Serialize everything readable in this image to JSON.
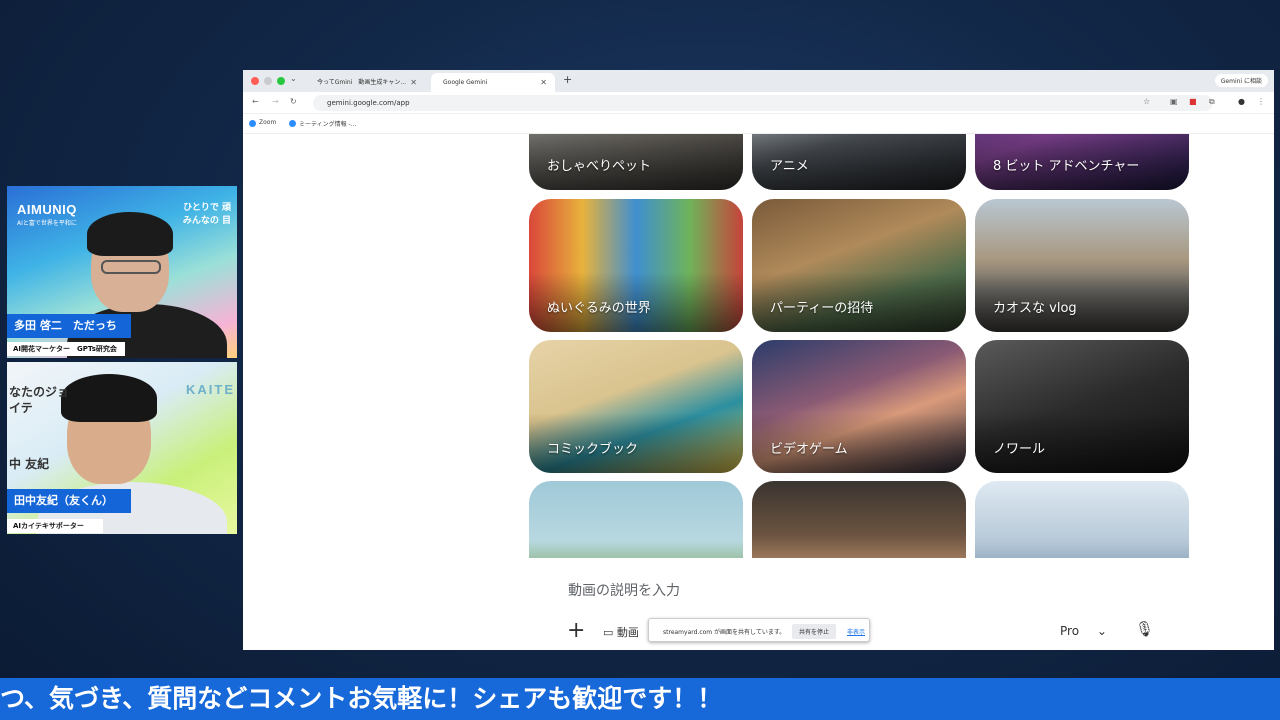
{
  "stream": {
    "ticker_text": "つ、気づき、質問などコメントお気軽に！シェアも歓迎です！！"
  },
  "webcam1": {
    "brand": "AIMUNIQ",
    "brand_sub": "AIと富で世界を平和に",
    "tag_line1": "ひとりで 頑",
    "tag_line2": "みんなの 目",
    "name": "多田 啓二　ただっち",
    "role": "AI開花マーケター　GPTs研究会"
  },
  "webcam2": {
    "tag": "KAITE",
    "side_line1": "なたのジョ",
    "side_line2": "イテ",
    "side_line3": "中 友紀",
    "name": "田中友紀（友くん）",
    "role": "AIカイテキサポーター"
  },
  "browser": {
    "tabs": [
      {
        "label": "今ってGmini　動画生成キャン..."
      },
      {
        "label": "Google Gemini"
      }
    ],
    "new_tab": "+",
    "gemini_button": "Gemini に相談",
    "url": "gemini.google.com/app",
    "bookmarks": [
      {
        "label": "Zoom"
      },
      {
        "label": "ミーティング情報 -..."
      }
    ]
  },
  "gemini": {
    "cards": [
      {
        "label": "おしゃべりペット"
      },
      {
        "label": "アニメ"
      },
      {
        "label": "8 ビット アドベンチャー"
      },
      {
        "label": "ぬいぐるみの世界"
      },
      {
        "label": "パーティーの招待"
      },
      {
        "label": "カオスな vlog"
      },
      {
        "label": "コミックブック"
      },
      {
        "label": "ビデオゲーム"
      },
      {
        "label": "ノワール"
      },
      {
        "label": ""
      },
      {
        "label": ""
      },
      {
        "label": ""
      }
    ],
    "prompt_placeholder": "動画の説明を入力",
    "plus": "+",
    "video_chip": "動画",
    "model": "Pro",
    "share_bar": {
      "message": "streamyard.com が画面を共有しています。",
      "stop": "共有を停止",
      "hide": "非表示"
    }
  }
}
